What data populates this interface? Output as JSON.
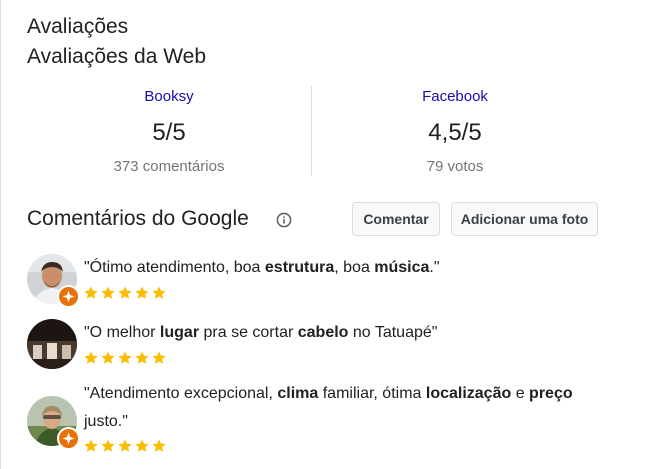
{
  "header": {
    "title": "Avaliações",
    "subtitle": "Avaliações da Web"
  },
  "web_reviews": [
    {
      "source": "Booksy",
      "score": "5/5",
      "count": "373 comentários"
    },
    {
      "source": "Facebook",
      "score": "4,5/5",
      "count": "79 votos"
    }
  ],
  "google": {
    "title": "Comentários do Google",
    "comment_button": "Comentar",
    "add_photo_button": "Adicionar uma foto"
  },
  "reviews": [
    {
      "parts": [
        "\"Ótimo atendimento, boa ",
        "estrutura",
        ", boa ",
        "música",
        ".\""
      ],
      "stars": 5,
      "local_guide": true
    },
    {
      "parts": [
        "\"O melhor ",
        "lugar",
        " pra se cortar ",
        "cabelo",
        " no Tatuapé\""
      ],
      "stars": 5,
      "local_guide": false
    },
    {
      "parts": [
        "\"Atendimento excepcional, ",
        "clima",
        " familiar, ótima ",
        "localização",
        " e ",
        "preço",
        " justo.\""
      ],
      "stars": 5,
      "local_guide": true
    }
  ],
  "colors": {
    "star": "#fbbc04",
    "link": "#1a0dab",
    "badge": "#e8710a",
    "muted": "#70757a"
  },
  "icons": [
    "info-icon",
    "star-icon",
    "local-guide-badge-icon"
  ]
}
